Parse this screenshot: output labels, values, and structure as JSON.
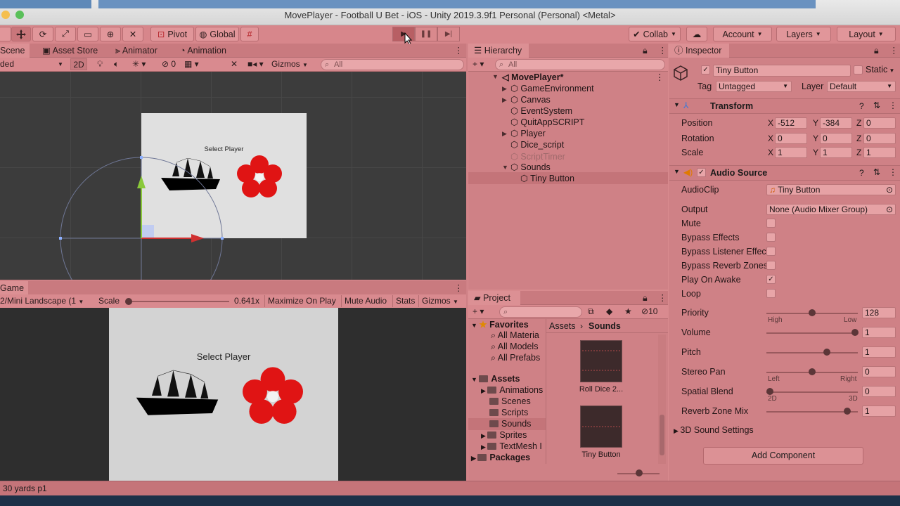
{
  "window": {
    "title": "MovePlayer - Football U Bet - iOS - Unity 2019.3.9f1 Personal (Personal) <Metal>"
  },
  "toolbar": {
    "pivot": "Pivot",
    "global": "Global",
    "collab": "Collab",
    "account": "Account",
    "layers": "Layers",
    "layout": "Layout"
  },
  "scene": {
    "tabs": [
      "Scene",
      "Asset Store",
      "Animator",
      "Animation"
    ],
    "shading": "ded",
    "mode_2d": "2D",
    "hidden_count": "0",
    "gizmos": "Gizmos",
    "search_placeholder": "All",
    "canvas_label": "Select Player"
  },
  "game": {
    "tab": "Game",
    "display": "2/Mini Landscape (1",
    "scale_label": "Scale",
    "scale_value": "0.641x",
    "maximize": "Maximize On Play",
    "mute": "Mute Audio",
    "stats": "Stats",
    "gizmos": "Gizmos",
    "canvas_label": "Select Player"
  },
  "hierarchy": {
    "tab": "Hierarchy",
    "search_placeholder": "All",
    "root": "MovePlayer*",
    "items": [
      "GameEnvironment",
      "Canvas",
      "EventSystem",
      "QuitAppSCRIPT",
      "Player",
      "Dice_script",
      "ScriptTimer",
      "Sounds",
      "Tiny Button"
    ]
  },
  "inspector": {
    "tab": "Inspector",
    "object_name": "Tiny Button",
    "static_label": "Static",
    "tag_label": "Tag",
    "tag_value": "Untagged",
    "layer_label": "Layer",
    "layer_value": "Default",
    "transform": {
      "title": "Transform",
      "position_label": "Position",
      "rotation_label": "Rotation",
      "scale_label": "Scale",
      "position": [
        "-512",
        "-384",
        "0"
      ],
      "rotation": [
        "0",
        "0",
        "0"
      ],
      "scale": [
        "1",
        "1",
        "1"
      ],
      "axes": [
        "X",
        "Y",
        "Z"
      ]
    },
    "audio": {
      "title": "Audio Source",
      "audioclip_label": "AudioClip",
      "audioclip_value": "Tiny Button",
      "output_label": "Output",
      "output_value": "None (Audio Mixer Group)",
      "mute": "Mute",
      "bypass_effects": "Bypass Effects",
      "bypass_listener": "Bypass Listener Effec",
      "bypass_reverb": "Bypass Reverb Zones",
      "play_on_awake": "Play On Awake",
      "loop": "Loop",
      "priority_label": "Priority",
      "priority_value": "128",
      "priority_min": "High",
      "priority_max": "Low",
      "volume_label": "Volume",
      "volume_value": "1",
      "pitch_label": "Pitch",
      "pitch_value": "1",
      "stereo_label": "Stereo Pan",
      "stereo_value": "0",
      "stereo_min": "Left",
      "stereo_max": "Right",
      "spatial_label": "Spatial Blend",
      "spatial_value": "0",
      "spatial_min": "2D",
      "spatial_max": "3D",
      "reverb_label": "Reverb Zone Mix",
      "reverb_value": "1",
      "sound3d": "3D Sound Settings"
    },
    "add_component": "Add Component"
  },
  "project": {
    "tab": "Project",
    "hidden_count": "10",
    "favorites": "Favorites",
    "fav_items": [
      "All Materia",
      "All Models",
      "All Prefabs"
    ],
    "assets": "Assets",
    "asset_folders": [
      "Animations",
      "Scenes",
      "Scripts",
      "Sounds",
      "Sprites",
      "TextMesh I"
    ],
    "packages": "Packages",
    "breadcrumb_root": "Assets",
    "breadcrumb_current": "Sounds",
    "files": [
      "Roll Dice 2...",
      "Tiny Button"
    ]
  },
  "status": {
    "text": "30 yards p1"
  },
  "colors": {
    "tint": "#d88a8e",
    "scene_bg": "#3c3c3c",
    "game_bg": "#d3d3d3"
  }
}
